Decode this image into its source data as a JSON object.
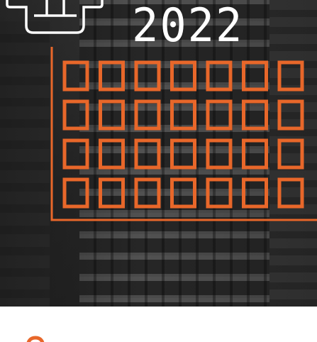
{
  "cover": {
    "year": "2022",
    "accent_color": "#e8672a",
    "icon": "calendar-icon",
    "grid": {
      "rows": 4,
      "columns": 7
    },
    "photo": "office-building-photo"
  },
  "footer": {
    "logo_icon": "orange-arc-logo-icon"
  }
}
